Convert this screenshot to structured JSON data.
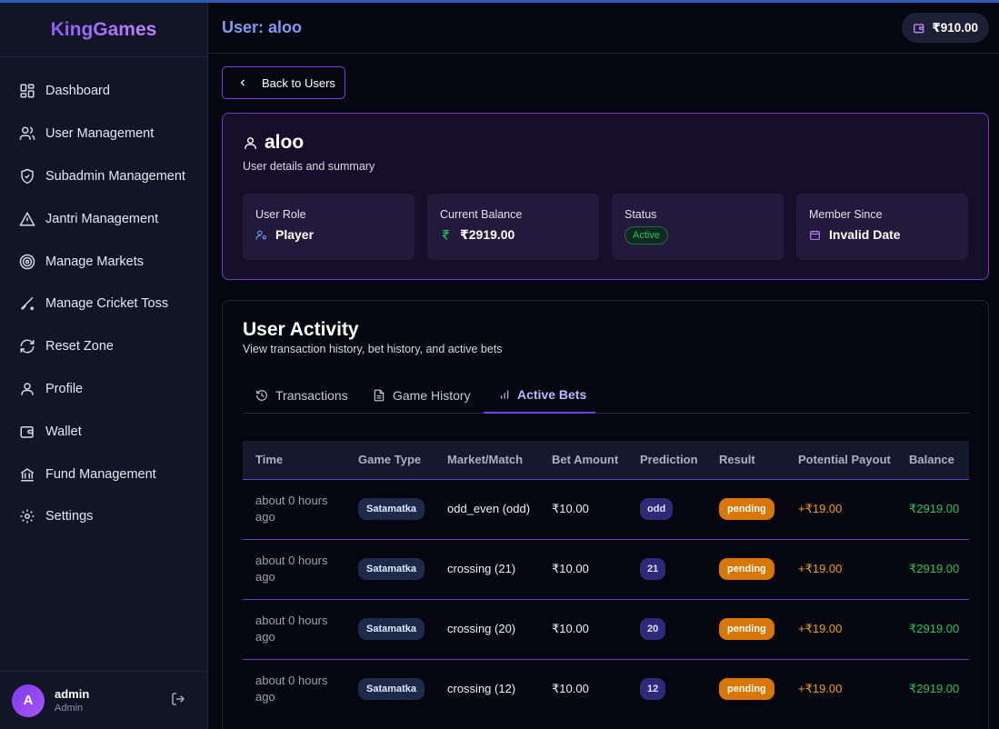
{
  "sidebar": {
    "brand": "KingGames",
    "items": [
      {
        "label": "Dashboard",
        "icon": "dashboard-icon"
      },
      {
        "label": "User Management",
        "icon": "users-icon"
      },
      {
        "label": "Subadmin Management",
        "icon": "shield-icon"
      },
      {
        "label": "Jantri Management",
        "icon": "warning-icon"
      },
      {
        "label": "Manage Markets",
        "icon": "target-icon"
      },
      {
        "label": "Manage Cricket Toss",
        "icon": "bat-icon"
      },
      {
        "label": "Reset Zone",
        "icon": "refresh-icon"
      },
      {
        "label": "Profile",
        "icon": "user-icon"
      },
      {
        "label": "Wallet",
        "icon": "wallet-icon"
      },
      {
        "label": "Fund Management",
        "icon": "bank-icon"
      },
      {
        "label": "Settings",
        "icon": "gear-icon"
      }
    ],
    "footer": {
      "avatar_letter": "A",
      "name": "admin",
      "role": "Admin"
    }
  },
  "header": {
    "title": "User: aloo",
    "balance": "₹910.00"
  },
  "back_label": "Back to Users",
  "summary": {
    "name": "aloo",
    "subtitle": "User details and summary",
    "stats": {
      "role_label": "User Role",
      "role_value": "Player",
      "balance_label": "Current Balance",
      "balance_value": "₹2919.00",
      "status_label": "Status",
      "status_value": "Active",
      "since_label": "Member Since",
      "since_value": "Invalid Date"
    }
  },
  "activity": {
    "title": "User Activity",
    "subtitle": "View transaction history, bet history, and active bets",
    "tabs": [
      "Transactions",
      "Game History",
      "Active Bets"
    ],
    "active_tab": "Active Bets",
    "columns": [
      "Time",
      "Game Type",
      "Market/Match",
      "Bet Amount",
      "Prediction",
      "Result",
      "Potential Payout",
      "Balance"
    ],
    "rows": [
      {
        "time": "about 0 hours ago",
        "game_type": "Satamatka",
        "market": "odd_even (odd)",
        "amount": "₹10.00",
        "prediction": "odd",
        "result": "pending",
        "payout": "+₹19.00",
        "balance": "₹2919.00"
      },
      {
        "time": "about 0 hours ago",
        "game_type": "Satamatka",
        "market": "crossing (21)",
        "amount": "₹10.00",
        "prediction": "21",
        "result": "pending",
        "payout": "+₹19.00",
        "balance": "₹2919.00"
      },
      {
        "time": "about 0 hours ago",
        "game_type": "Satamatka",
        "market": "crossing (20)",
        "amount": "₹10.00",
        "prediction": "20",
        "result": "pending",
        "payout": "+₹19.00",
        "balance": "₹2919.00"
      },
      {
        "time": "about 0 hours ago",
        "game_type": "Satamatka",
        "market": "crossing (12)",
        "amount": "₹10.00",
        "prediction": "12",
        "result": "pending",
        "payout": "+₹19.00",
        "balance": "₹2919.00"
      }
    ]
  },
  "colors": {
    "accent": "#7c3aed",
    "title_blue": "#7e9cf0",
    "pending": "#d97706",
    "balance_green": "#22c55e",
    "payout_orange": "#f59e0b"
  }
}
